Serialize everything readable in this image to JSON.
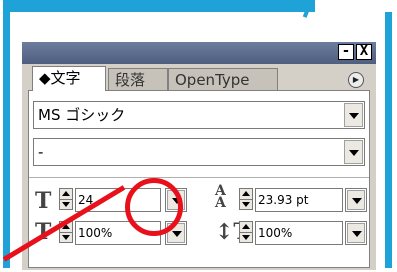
{
  "palette": {
    "tabs": [
      {
        "label": "◆文字",
        "active": true
      },
      {
        "label": "段落",
        "active": false
      },
      {
        "label": "OpenType",
        "active": false
      }
    ],
    "title_buttons": [
      "-",
      "X"
    ],
    "menu_icon": "arrow-menu-icon"
  },
  "font_family": {
    "value": "MS ゴシック"
  },
  "font_style": {
    "value": "-"
  },
  "font_size": {
    "value": "24"
  },
  "leading": {
    "value": "23.93 pt"
  },
  "horizontal_scale": {
    "value": "100%"
  },
  "vertical_scale": {
    "value": "100%"
  },
  "colors": {
    "frame": "#1ea2d8",
    "highlight": "#e8101a",
    "titlebar": "#5a6a8a"
  }
}
